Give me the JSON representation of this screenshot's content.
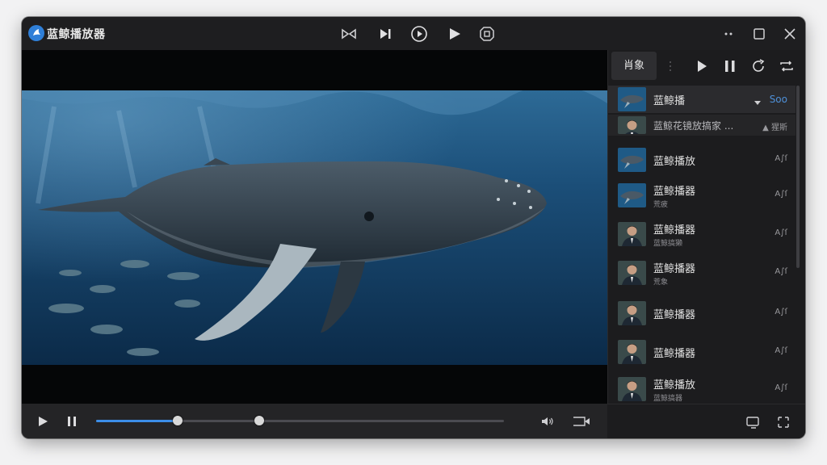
{
  "app": {
    "title": "蓝鲸播放器",
    "accent": "#2f7fd8"
  },
  "titlebar_controls": [
    "rewind-icon",
    "next-icon",
    "play-circle-icon",
    "play-icon",
    "screenshot-icon"
  ],
  "window_controls": [
    "more-icon",
    "maximize-icon",
    "close-icon"
  ],
  "player": {
    "progress": 0.2,
    "second_marker": 0.4,
    "progress_color": "#3c8ee8"
  },
  "sidebar": {
    "tab_label": "肖象",
    "header_controls": [
      "play-icon",
      "pause-icon",
      "refresh-icon",
      "repeat-icon"
    ],
    "items": [
      {
        "title": "蓝鲸播",
        "subtitle": "",
        "badge": "Soo",
        "thumb": "whale",
        "active": true
      },
      {
        "title": "蓝鲸花镜放搞家 ...",
        "subtitle": "",
        "badge": "▲ 猩斯",
        "thumb": "person",
        "active": false
      },
      {
        "title": "蓝鲸播放",
        "subtitle": "",
        "badge": "A∫ſ",
        "thumb": "whale",
        "active": false
      },
      {
        "title": "蓝鲸播器",
        "subtitle": "荒疲",
        "badge": "A∫ſ",
        "thumb": "whale",
        "active": false
      },
      {
        "title": "蓝鲸播器",
        "subtitle": "蓝鲸搞獭",
        "badge": "A∫ſ",
        "thumb": "person",
        "active": false
      },
      {
        "title": "蓝鲸播器",
        "subtitle": "荒象",
        "badge": "A∫ſ",
        "thumb": "person",
        "active": false
      },
      {
        "title": "蓝鲸播器",
        "subtitle": "",
        "badge": "A∫ſ",
        "thumb": "person",
        "active": false
      },
      {
        "title": "蓝鲸播器",
        "subtitle": "",
        "badge": "A∫ſ",
        "thumb": "person",
        "active": false
      },
      {
        "title": "蓝鲸播放",
        "subtitle": "蓝鲸搞器",
        "badge": "A∫ſ",
        "thumb": "person",
        "active": false
      }
    ]
  }
}
